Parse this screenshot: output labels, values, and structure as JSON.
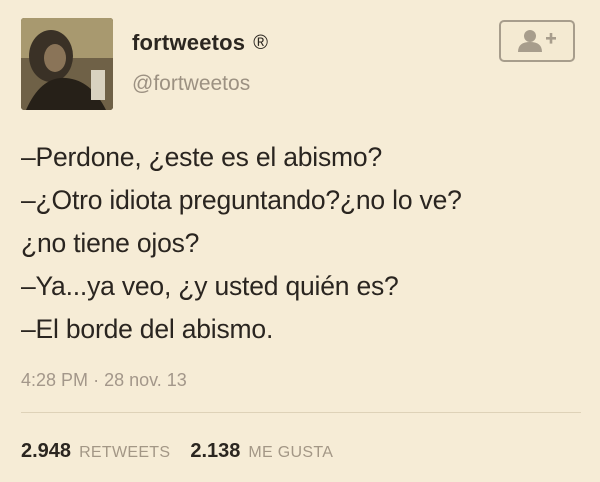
{
  "author": {
    "display_name": "fortweetos",
    "verified_mark": "®",
    "handle": "@fortweetos"
  },
  "follow_button": {
    "icon": "add-user-icon"
  },
  "tweet": {
    "lines": [
      "–Perdone, ¿este es el abismo?",
      "–¿Otro idiota preguntando?¿no lo ve?",
      "¿no tiene ojos?",
      "–Ya...ya veo, ¿y usted quién es?",
      "–El borde del abismo."
    ],
    "time": "4:28 PM",
    "separator": "·",
    "date": "28 nov. 13"
  },
  "stats": {
    "retweets_count": "2.948",
    "retweets_label": "RETWEETS",
    "likes_count": "2.138",
    "likes_label": "ME GUSTA"
  },
  "colors": {
    "background": "#f6ecd6",
    "text": "#2a2520",
    "muted": "#9c9182"
  }
}
